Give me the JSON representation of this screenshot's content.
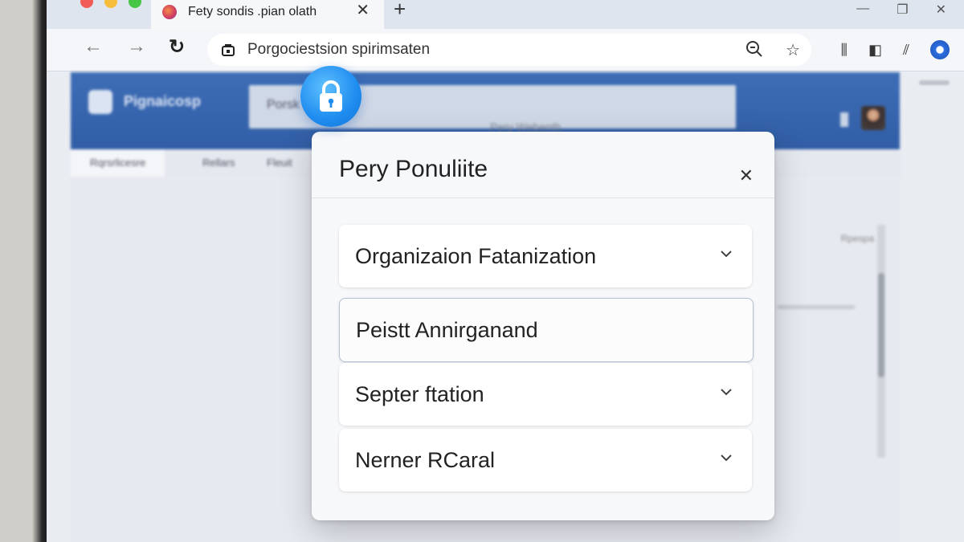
{
  "browser": {
    "tab": {
      "title": "Fety sondis .pian olath",
      "favicon_icon": "app-favicon-icon",
      "close_icon": "close-icon"
    },
    "new_tab_label": "+",
    "url": "Porgociestsion spirimsaten"
  },
  "app": {
    "name": "Pignaicosp",
    "search_label": "Porsk",
    "search_hint": "Pery Webenth",
    "tabs": [
      "Rqrsrlicesre",
      "Rellars",
      "Fleuit"
    ],
    "right_label": "Rpespa"
  },
  "dialog": {
    "title": "Pery Ponuliite",
    "options": [
      {
        "label": "Organizaion Fatanization",
        "has_chevron": true,
        "selected": false
      },
      {
        "label": "Peistt Annirganand",
        "has_chevron": false,
        "selected": true
      },
      {
        "label": "Septer ftation",
        "has_chevron": true,
        "selected": false
      },
      {
        "label": "Nerner RCaral",
        "has_chevron": true,
        "selected": false
      }
    ]
  },
  "colors": {
    "header_blue": "#3e6db6",
    "lock_blue": "#1e8cef",
    "dialog_bg": "#f7f8fa"
  }
}
